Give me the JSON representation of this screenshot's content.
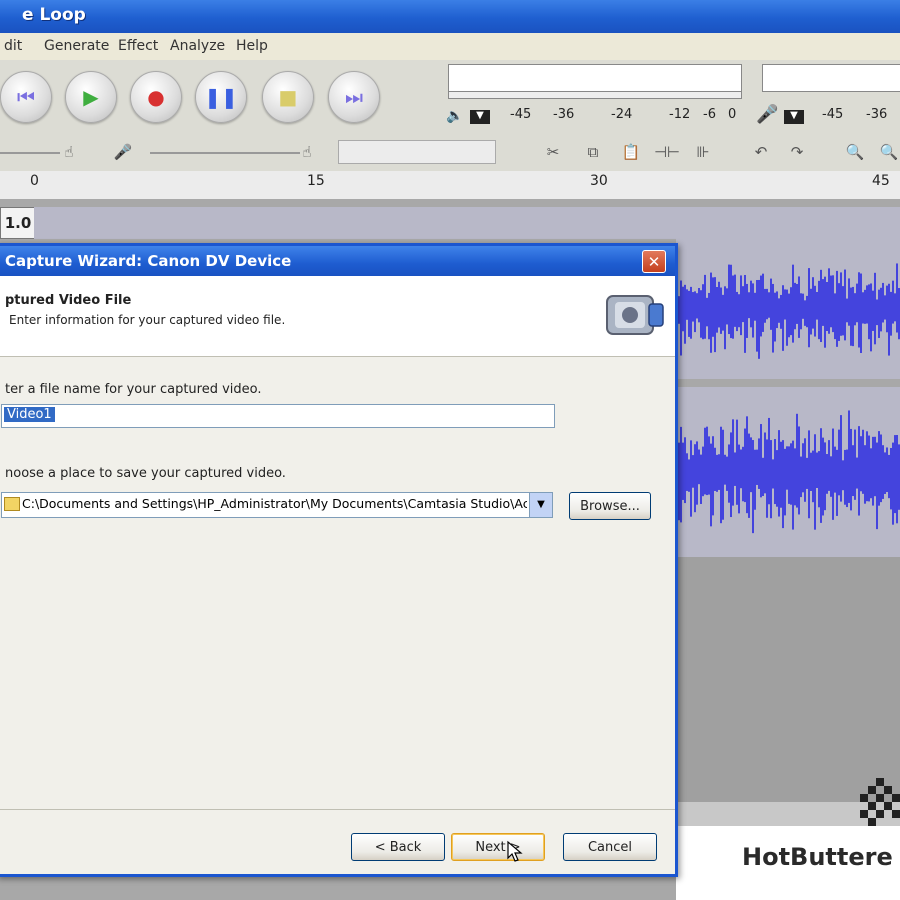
{
  "window": {
    "title": "e Loop"
  },
  "menu": [
    "dit",
    "Generate",
    "Effect",
    "Analyze",
    "Help"
  ],
  "transport": [
    {
      "name": "skip-start-icon",
      "glyph": "⏮",
      "color": "#7a6fe0"
    },
    {
      "name": "play-icon",
      "glyph": "▶",
      "color": "#3fae3f"
    },
    {
      "name": "record-icon",
      "glyph": "●",
      "color": "#d83030"
    },
    {
      "name": "pause-icon",
      "glyph": "❚❚",
      "color": "#3a5fe0"
    },
    {
      "name": "stop-icon",
      "glyph": "■",
      "color": "#d9cc6a"
    },
    {
      "name": "skip-end-icon",
      "glyph": "⏭",
      "color": "#7a6fe0"
    }
  ],
  "meters": {
    "playback_ticks": [
      "-45",
      "-36",
      "-24",
      "-12",
      "-6",
      "0"
    ],
    "record_ticks": [
      "-45",
      "-36"
    ]
  },
  "ruler": {
    "labels": [
      "0",
      "15",
      "30",
      "45"
    ]
  },
  "track": {
    "label": "1.0"
  },
  "dialog": {
    "title": "Capture Wizard: Canon DV Device",
    "close_glyph": "✕",
    "heading": "ptured Video File",
    "subheading": "Enter information for your captured video file.",
    "name_prompt": "ter a file name for your captured video.",
    "name_value": "Video1",
    "place_prompt": "noose a place to save your captured video.",
    "path_value": "C:\\Documents and Settings\\HP_Administrator\\My Documents\\Camtasia Studio\\Ac",
    "browse_label": "Browse...",
    "back_label": "< Back",
    "next_label": "Next >",
    "cancel_label": "Cancel"
  },
  "watermark": {
    "text": "HotButtere"
  },
  "colors": {
    "titlebar": "#1f5fd0",
    "waveform": "#4444dd",
    "dialog_bg": "#ece9d8"
  }
}
